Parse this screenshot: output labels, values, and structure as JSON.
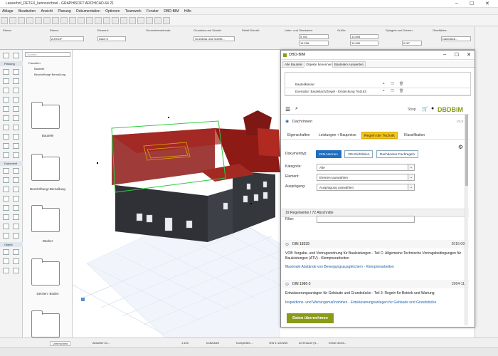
{
  "window": {
    "title": "Lasserhof_DETEX_kennzeichnet - GRAPHISOFT ARCHICAD-64 21",
    "menus": [
      "Ablage",
      "Bearbeiten",
      "Ansicht",
      "Planung",
      "Dokumentation",
      "Optionen",
      "Teamwork",
      "Fenster",
      "DBD-BIM",
      "Hilfe"
    ]
  },
  "infobox": {
    "labels": [
      "Ebene:",
      "Element:",
      "Geometriemethode:",
      "Grundriss und Schnitt:",
      "Relief-Schnitt:",
      "Unter- und Oberkante:",
      "Größe:",
      "Neigung:",
      "Spiegeln und Drehen:",
      "Oberfläche:"
    ],
    "ebene": "A-ROOF",
    "element": "Dach 6",
    "grundriss": "Grundriss und Schnitt...",
    "unterkante": "5.782",
    "oberkante": "14.296",
    "groesse1": "13.694",
    "groesse2": "12.000",
    "winkel": "0.00°",
    "oberflaeche": "Dachdeck..."
  },
  "navigator": {
    "search_placeholder": "Suchen",
    "section_planung": "Planung",
    "section_dokument": "Dokument",
    "section_objekt": "Objekt",
    "tree": [
      "Favoriten",
      "Bauteile",
      "Beschriftung+Bemaßung"
    ],
    "folders": [
      "Bauteile",
      "Beschriftung+Bemaßung",
      "Dächer",
      "Decken- Böden"
    ]
  },
  "view_tabs": [
    "[0. Erdgeschoss]",
    "[3D / Alle]"
  ],
  "dialog": {
    "title": "DBD-BIM",
    "tabs": [
      "Alle Bauteile",
      "Objekte benennen",
      "Bauteilen Auswerten"
    ],
    "grid_rows": [
      "Bauteilklasse:",
      "Exemplar: Bauteilach/Ziegel - Eindeckung 764163"
    ],
    "web": {
      "shop": "Shop",
      "brand": "DBDBIM",
      "category": "Dachrinnen",
      "version": "V3.8",
      "subtabs": [
        "Eigenschaften",
        "Leistungen + Baupreise",
        "Regeln der Technik",
        "Klassifikation"
      ],
      "dok_label": "Dokumenttyp:",
      "doc_buttons": [
        "DIN-Normen",
        "VDI-Richtlinien",
        "Dachdecker-Fachregeln"
      ],
      "kategorie_label": "Kategorie:",
      "kategorie_value": "Alle",
      "element_label": "Element:",
      "element_value": "Element auswählen",
      "auspraegung_label": "Ausprägung:",
      "auspraegung_value": "Ausprägung auswählen",
      "count": "19 Regelwerke / 72 Abschnitte",
      "filter_label": "Filter:",
      "norms": [
        {
          "code": "DIN 18339",
          "date": "2016-09",
          "desc": "VOB Vergabe- und Vertragsordnung für Bauleistungen - Teil C: Allgemeine Technische Vertragsbedingungen für Bauleistungen (ATV) - Klempnerarbeiten",
          "link": "Maximale Abstände von Bewegungsausgleichern - Klempnerarbeiten"
        },
        {
          "code": "DIN 1986-3",
          "date": "2004-11",
          "desc": "Entwässerungsanlagen für Gebäude und Grundstücke - Teil 3: Regeln für Betrieb und Wartung",
          "link": "Inspektions- und Wartungsmaßnahmen - Entwässerungsanlagen für Gebäude und Grundstücke"
        }
      ],
      "apply_label": "Daten übernehmen"
    }
  },
  "status": {
    "items": [
      "Aktueller Zo...",
      "1:100",
      "Individuell",
      "Komplettes ...",
      "S/W 1:100/200",
      "02 Entwurf (S...",
      "Keine Übers..."
    ],
    "undo": "Unterschied"
  },
  "colors": {
    "accent_green": "#8a9a19",
    "tab_highlight": "#f5c518",
    "select_blue": "#1d6fbf",
    "roof_red": "#8e1a16",
    "wall_dark": "#2f3136"
  }
}
